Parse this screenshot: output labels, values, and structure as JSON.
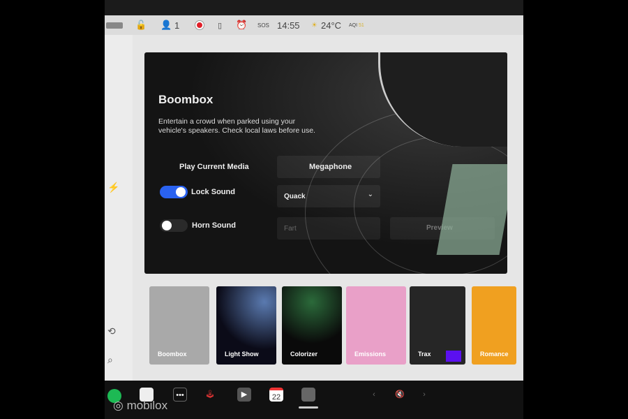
{
  "status": {
    "user_count": "1",
    "sos": "SOS",
    "time": "14:55",
    "temperature": "24°C",
    "aqi_label": "AQI",
    "aqi_value": "51"
  },
  "card": {
    "title": "Boombox",
    "description": "Entertain a crowd when parked using your vehicle's speakers. Check local laws before use.",
    "play_current_media": "Play Current Media",
    "megaphone": "Megaphone",
    "lock_sound": {
      "label": "Lock Sound",
      "on": true
    },
    "horn_sound": {
      "label": "Horn Sound",
      "on": false
    },
    "lock_sound_select": "Quack",
    "horn_sound_select": "Fart",
    "preview": "Preview"
  },
  "tiles": [
    {
      "label": "Boombox",
      "color": "#a9a9a9"
    },
    {
      "label": "Light Show",
      "color": "#0b0b18"
    },
    {
      "label": "Colorizer",
      "color": "#0a0a0a"
    },
    {
      "label": "Emissions",
      "color": "#e9a0c8"
    },
    {
      "label": "Trax",
      "color": "#262626"
    },
    {
      "label": "Romance",
      "color": "#f0a020"
    }
  ],
  "dock": {
    "calendar_day": "22",
    "watermark": "mobilox"
  },
  "colors": {
    "accent": "#2a62f0",
    "record": "#e0202a"
  }
}
